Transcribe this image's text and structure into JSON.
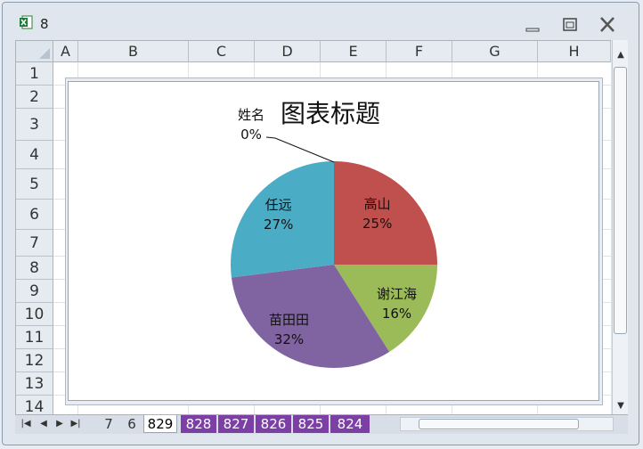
{
  "window": {
    "title": "8"
  },
  "columns": [
    "A",
    "B",
    "C",
    "D",
    "E",
    "F",
    "G",
    "H"
  ],
  "rows": [
    "1",
    "2",
    "3",
    "4",
    "5",
    "6",
    "7",
    "8",
    "9",
    "10",
    "11",
    "12",
    "13",
    "14"
  ],
  "chart_data": {
    "type": "pie",
    "title": "图表标题",
    "slices": [
      {
        "label": "姓名",
        "value": 0,
        "percent_text": "0%",
        "color": "#4a7ebb"
      },
      {
        "label": "高山",
        "value": 25,
        "percent_text": "25%",
        "color": "#c0504d"
      },
      {
        "label": "谢江海",
        "value": 16,
        "percent_text": "16%",
        "color": "#9bbb59"
      },
      {
        "label": "苗田田",
        "value": 32,
        "percent_text": "32%",
        "color": "#8064a2"
      },
      {
        "label": "任远",
        "value": 27,
        "percent_text": "27%",
        "color": "#4bacc6"
      }
    ]
  },
  "sheet_tabs": [
    {
      "label": "7",
      "style": "plain"
    },
    {
      "label": "6",
      "style": "plain"
    },
    {
      "label": "829",
      "style": "active"
    },
    {
      "label": "828",
      "style": "purple"
    },
    {
      "label": "827",
      "style": "purple"
    },
    {
      "label": "826",
      "style": "purple"
    },
    {
      "label": "825",
      "style": "purple"
    },
    {
      "label": "824",
      "style": "purple"
    }
  ]
}
